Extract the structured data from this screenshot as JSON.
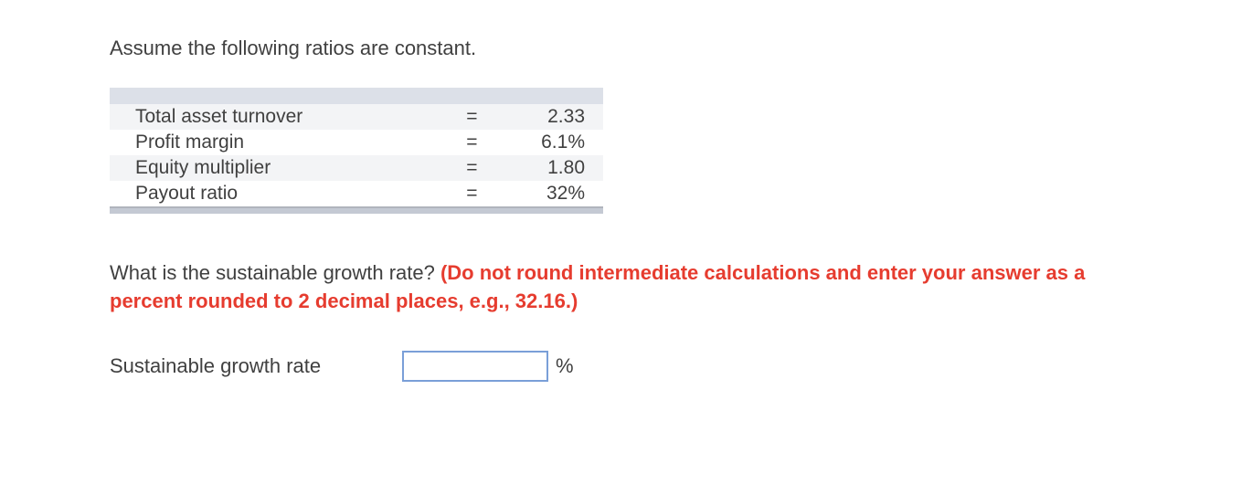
{
  "intro": "Assume the following ratios are constant.",
  "ratios": [
    {
      "label": "Total asset turnover",
      "eq": "=",
      "value": "2.33"
    },
    {
      "label": "Profit margin",
      "eq": "=",
      "value": "6.1%"
    },
    {
      "label": "Equity multiplier",
      "eq": "=",
      "value": "1.80"
    },
    {
      "label": "Payout ratio",
      "eq": "=",
      "value": "32%"
    }
  ],
  "question_plain": "What is the sustainable growth rate? ",
  "question_hint": "(Do not round intermediate calculations and enter your answer as a percent rounded to 2 decimal places, e.g., 32.16.)",
  "answer_label": "Sustainable growth rate",
  "answer_value": "",
  "unit": "%"
}
